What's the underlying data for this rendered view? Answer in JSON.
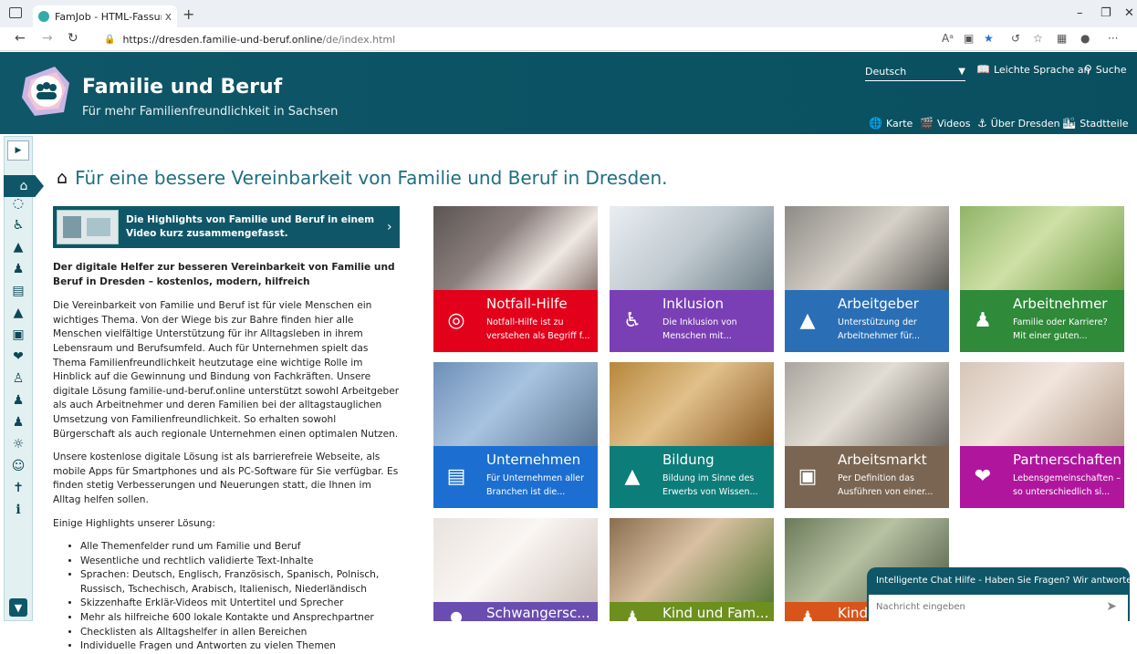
{
  "browser": {
    "tab_title": "FamJob - HTML-Fassung Für ein",
    "tab_close": "x",
    "new_tab": "+",
    "url_host": "https://dresden.familie-und-beruf.online",
    "url_path": "/de/index.html",
    "icons": [
      "back-icon",
      "forward-icon",
      "reload-icon",
      "lock-icon",
      "read-aloud-icon",
      "immersive-reader-icon",
      "favorite-star-icon",
      "extensions-icon",
      "collections-icon",
      "browser-essentials-icon",
      "profile-icon",
      "more-icon"
    ]
  },
  "header": {
    "brand": "Familie und Beruf",
    "tagline": "Für mehr Familienfreundlichkeit in Sachsen",
    "language": "Deutsch",
    "easy_language": "Leichte Sprache an",
    "search": "Suche",
    "nav": [
      "Karte",
      "Videos",
      "Über Dresden",
      "Stadtteile"
    ]
  },
  "main": {
    "title": "Für eine bessere Vereinbarkeit von Familie und Beruf in Dresden.",
    "video_banner": "Die Highlights von Familie und Beruf in einem Video kurz zusammengefasst.",
    "lead": "Der digitale Helfer zur besseren Vereinbarkeit von Familie und Beruf in Dresden – kostenlos, modern, hilfreich",
    "para1": "Die Vereinbarkeit von Familie und Beruf ist für viele Menschen ein wichtiges Thema. Von der Wiege bis zur Bahre finden hier alle Menschen vielfältige Unterstützung für ihr Alltagsleben in ihrem Lebensraum und Berufsumfeld. Auch für Unternehmen spielt das Thema Familienfreundlichkeit heutzutage eine wichtige Rolle im Hinblick auf die Gewinnung und Bindung von Fachkräften. Unsere digitale Lösung familie-und-beruf.online unterstützt sowohl Arbeitgeber als auch Arbeitnehmer und deren Familien bei der alltagstauglichen Umsetzung von Familienfreundlichkeit. So erhalten sowohl Bürgerschaft als auch regionale Unternehmen einen optimalen Nutzen.",
    "para2": "Unsere kostenlose digitale Lösung ist als barrierefreie Webseite, als mobile Apps für Smartphones und als PC-Software für Sie verfügbar. Es finden stetig Verbesserungen und Neuerungen statt, die Ihnen im Alltag helfen sollen.",
    "highlights_intro": "Einige Highlights unserer Lösung:",
    "highlights": [
      "Alle Themenfelder rund um Familie und Beruf",
      "Wesentliche und rechtlich validierte Text-Inhalte",
      "Sprachen: Deutsch, Englisch, Französisch, Spanisch, Polnisch, Russisch, Tschechisch, Arabisch, Italienisch, Niederländisch",
      "Skizzenhafte Erklär-Videos mit Untertitel und Sprecher",
      "Mehr als hilfreiche 600 lokale Kontakte und Ansprechpartner",
      "Checklisten als Alltagshelfer in allen Bereichen",
      "Individuelle Fragen und Antworten zu vielen Themen"
    ]
  },
  "tiles": [
    {
      "title": "Notfall-Hilfe",
      "desc": "Notfall-Hilfe ist zu verstehen als Begriff f...",
      "color": "#e2001a",
      "icon": "emergency-icon"
    },
    {
      "title": "Inklusion",
      "desc": "Die Inklusion von Menschen mit...",
      "color": "#7a3fb5",
      "icon": "wheelchair-icon"
    },
    {
      "title": "Arbeitgeber",
      "desc": "Unterstützung der Arbeitnehmer für...",
      "color": "#2a6fb6",
      "icon": "tie-icon"
    },
    {
      "title": "Arbeitnehmer",
      "desc": "Familie oder Karriere? Mit einer guten...",
      "color": "#2f8a39",
      "icon": "family-icon"
    },
    {
      "title": "Unternehmen",
      "desc": "Für Unternehmen aller Branchen ist die...",
      "color": "#1c6fd1",
      "icon": "factory-icon"
    },
    {
      "title": "Bildung",
      "desc": "Bildung im Sinne des Erwerbs von Wissen...",
      "color": "#0d7d7a",
      "icon": "graduation-icon"
    },
    {
      "title": "Arbeitsmarkt",
      "desc": "Per Definition das Ausführen von einer...",
      "color": "#7a6552",
      "icon": "briefcase-icon"
    },
    {
      "title": "Partnerschaften",
      "desc": "Lebensgemeinschaften – so unterschiedlich si...",
      "color": "#b0169d",
      "icon": "hearts-icon"
    },
    {
      "title": "Schwangersc...",
      "desc": "",
      "color": "#6a4db0",
      "icon": "pregnancy-icon"
    },
    {
      "title": "Kind und Fam...",
      "desc": "",
      "color": "#6d8f1e",
      "icon": "child-icon"
    },
    {
      "title": "Kind",
      "desc": "",
      "color": "#d9541a",
      "icon": "kids-icon"
    }
  ],
  "chat": {
    "header": "Intelligente Chat Hilfe - Haben Sie Fragen? Wir antworten!",
    "placeholder": "Nachricht eingeben"
  }
}
